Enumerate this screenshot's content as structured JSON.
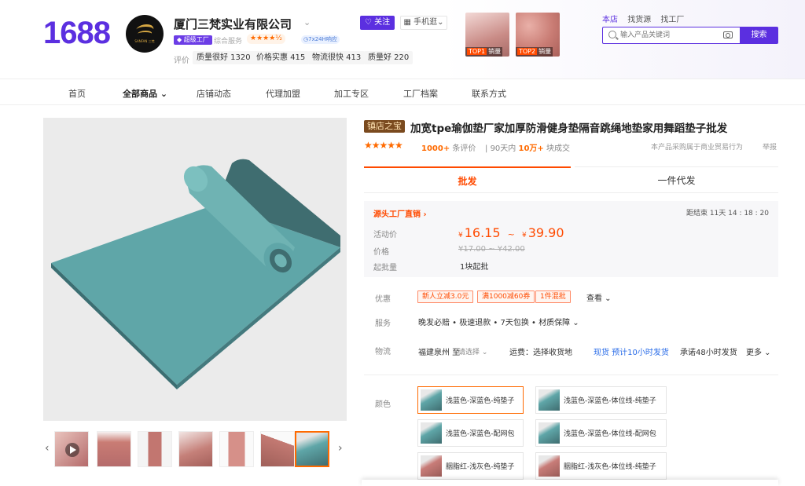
{
  "header": {
    "logo": "1688",
    "shop_logo_text": "SANFAN 三梵",
    "shop_name": "厦门三梵实业有限公司",
    "super_factory": "超级工厂",
    "service_label": "综合服务",
    "service_stars": "★★★★½",
    "response_badge": "7x24H响应",
    "rating_label": "评价",
    "ratings": [
      {
        "label": "质量很好 1320"
      },
      {
        "label": "价格实惠 415"
      },
      {
        "label": "物流很快 413"
      },
      {
        "label": "质量好 220"
      }
    ],
    "follow": "关注",
    "mobile": "手机逛",
    "top_cards": [
      {
        "tag": "TOP1",
        "text": "销量"
      },
      {
        "tag": "TOP2",
        "text": "销量"
      }
    ],
    "search_tabs": [
      "本店",
      "找货源",
      "找工厂"
    ],
    "search_placeholder": "输入产品关键词",
    "search_button": "搜索"
  },
  "nav": {
    "items": [
      "首页",
      "全部商品",
      "店铺动态",
      "代理加盟",
      "加工专区",
      "工厂档案",
      "联系方式"
    ]
  },
  "product": {
    "shop_tag": "镇店之宝",
    "title": "加宽tpe瑜伽垫厂家加厚防滑健身垫隔音跳绳地垫家用舞蹈垫子批发",
    "stars": "★★★★★",
    "eval_count": "1000+",
    "eval_suffix": "条评价",
    "sold_prefix": "90天内",
    "sold_count": "10万+",
    "sold_suffix": "块成交",
    "policy": "本产品采购属于商业贸易行为",
    "report": "举报",
    "tabs": [
      "批发",
      "一件代发"
    ],
    "price": {
      "factory_direct": "源头工厂直销 ›",
      "countdown": "距结束 11天 14 : 18 : 20",
      "activity_label": "活动价",
      "currency": "¥",
      "price_low": "16.15",
      "sep": "~",
      "price_high": "39.90",
      "orig_label": "价格",
      "orig_price": "¥17.00 ~ ¥42.00",
      "moq_label": "起批量",
      "moq": "1块起批"
    },
    "discount_label": "优惠",
    "coupons": [
      "新人立减3.0元",
      "满1000减60券",
      "1件混批"
    ],
    "view_more": "查看 ⌄",
    "service_label": "服务",
    "service_text": "晚发必赔 • 极速退款 • 7天包换 • 材质保障 ⌄",
    "logistics_label": "物流",
    "logistics_from": "福建泉州  至",
    "logistics_to": "请选择 ⌄",
    "logistics_freight": "运费：选择收货地",
    "logistics_stock": "现货  预计10小时发货",
    "logistics_promise": "承诺48小时发货",
    "logistics_more": "更多 ⌄",
    "color_label": "颜色",
    "colors": [
      {
        "label": "浅蓝色-深蓝色-纯垫子",
        "tone": "#5fa6a8"
      },
      {
        "label": "浅蓝色-深蓝色-体位线-纯垫子",
        "tone": "#5fa6a8"
      },
      {
        "label": "浅蓝色-深蓝色-配网包",
        "tone": "#5fa6a8"
      },
      {
        "label": "浅蓝色-深蓝色-体位线-配网包",
        "tone": "#5fa6a8"
      },
      {
        "label": "胭脂红-浅灰色-纯垫子",
        "tone": "#b56b6b"
      },
      {
        "label": "胭脂红-浅灰色-体位线-纯垫子",
        "tone": "#b56b6b"
      }
    ]
  },
  "colors": {
    "brand": "#5b2fe0",
    "accent": "#ff4a00",
    "mat_teal": "#5fa6a8",
    "mat_pink": "#c87c78"
  }
}
